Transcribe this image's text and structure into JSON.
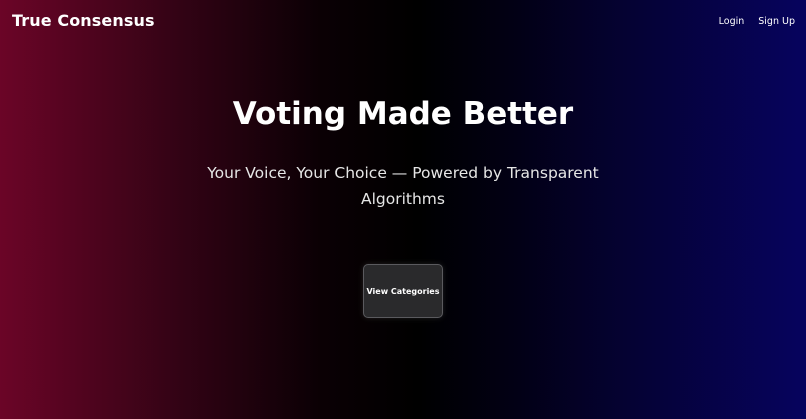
{
  "header": {
    "brand": "True Consensus",
    "nav": {
      "login": "Login",
      "signup": "Sign Up"
    }
  },
  "hero": {
    "title": "Voting Made Better",
    "subtitle": "Your Voice, Your Choice — Powered by Transparent Algorithms",
    "cta_label": "View Categories"
  },
  "colors": {
    "gradient_left": "#6b0527",
    "gradient_center": "#000000",
    "gradient_right": "#06035e",
    "button_bg": "#2a2a2c"
  }
}
